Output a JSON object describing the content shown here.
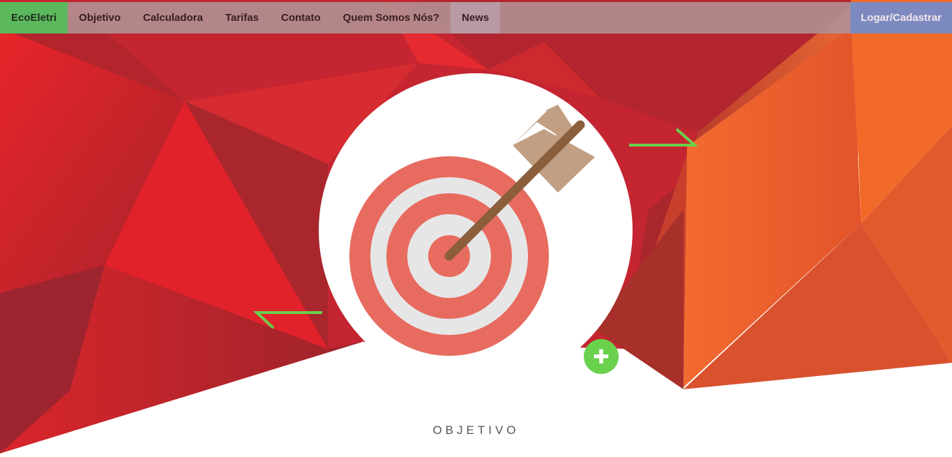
{
  "nav": {
    "brand": "EcoEletri",
    "items": [
      {
        "label": "Objetivo"
      },
      {
        "label": "Calculadora"
      },
      {
        "label": "Tarifas"
      },
      {
        "label": "Contato"
      },
      {
        "label": "Quem Somos Nós?"
      },
      {
        "label": "News"
      }
    ],
    "login_label": "Logar/Cadastrar"
  },
  "hero": {
    "icon": "target-arrow-icon",
    "plus_icon": "plus-icon",
    "plus_label": "✚",
    "accent_color": "#6ad14d"
  },
  "section": {
    "title": "OBJETIVO"
  }
}
